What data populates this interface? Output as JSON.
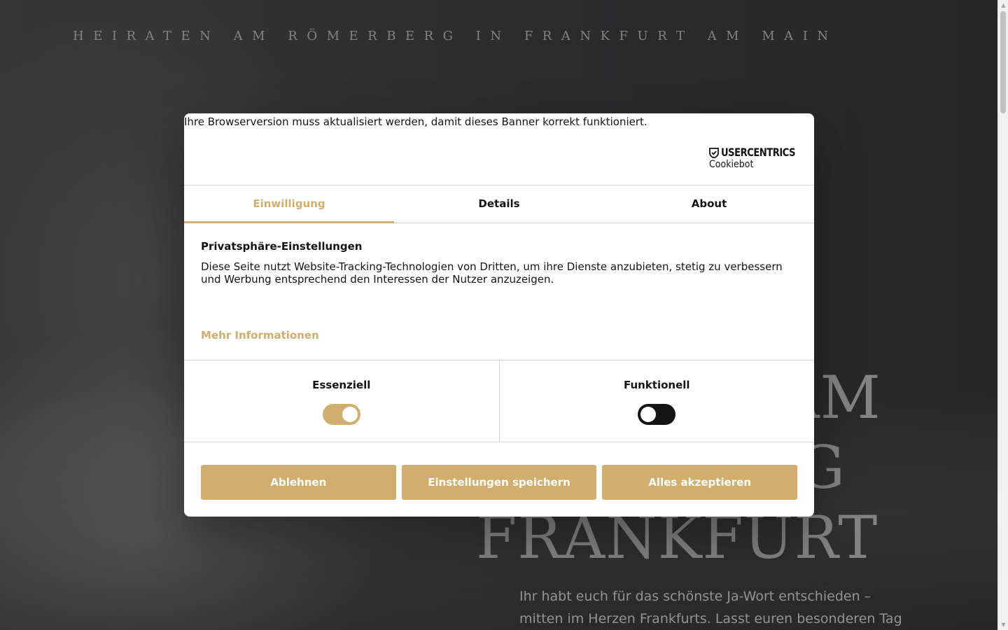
{
  "hero": {
    "subtitle": "Heiraten am Römerberg in Frankfurt am Main",
    "title_lines": [
      "AM",
      "G",
      "FRANKFURT"
    ],
    "text": "Ihr habt euch für das schönste Ja-Wort entschieden – mitten im Herzen  Frankfurts.  Lasst euren besonderen Tag ebenso stilvoll"
  },
  "cookie_banner": {
    "browser_warning": "Ihre Browserversion muss aktualisiert werden, damit dieses Banner korrekt funktioniert.",
    "logo": {
      "brand": "USERCENTRICS",
      "product": "Cookiebot",
      "icon": "shield-icon"
    },
    "tabs": [
      {
        "label": "Einwilligung",
        "active": true
      },
      {
        "label": "Details",
        "active": false
      },
      {
        "label": "About",
        "active": false
      }
    ],
    "heading": "Privatsphäre-Einstellungen",
    "body": "Diese Seite nutzt Website-Tracking-Technologien von Dritten, um ihre Dienste anzubieten, stetig zu verbessern und Werbung entsprechend den Interessen der Nutzer anzuzeigen.",
    "more_info": "Mehr Informationen",
    "toggles": [
      {
        "label": "Essenziell",
        "enabled": true
      },
      {
        "label": "Funktionell",
        "enabled": false
      }
    ],
    "buttons": {
      "decline": "Ablehnen",
      "save": "Einstellungen speichern",
      "accept_all": "Alles akzeptieren"
    }
  },
  "colors": {
    "accent": "#d2ae6d",
    "text": "#141414",
    "background": "#2d2d2e",
    "toggle_off": "#141414"
  }
}
